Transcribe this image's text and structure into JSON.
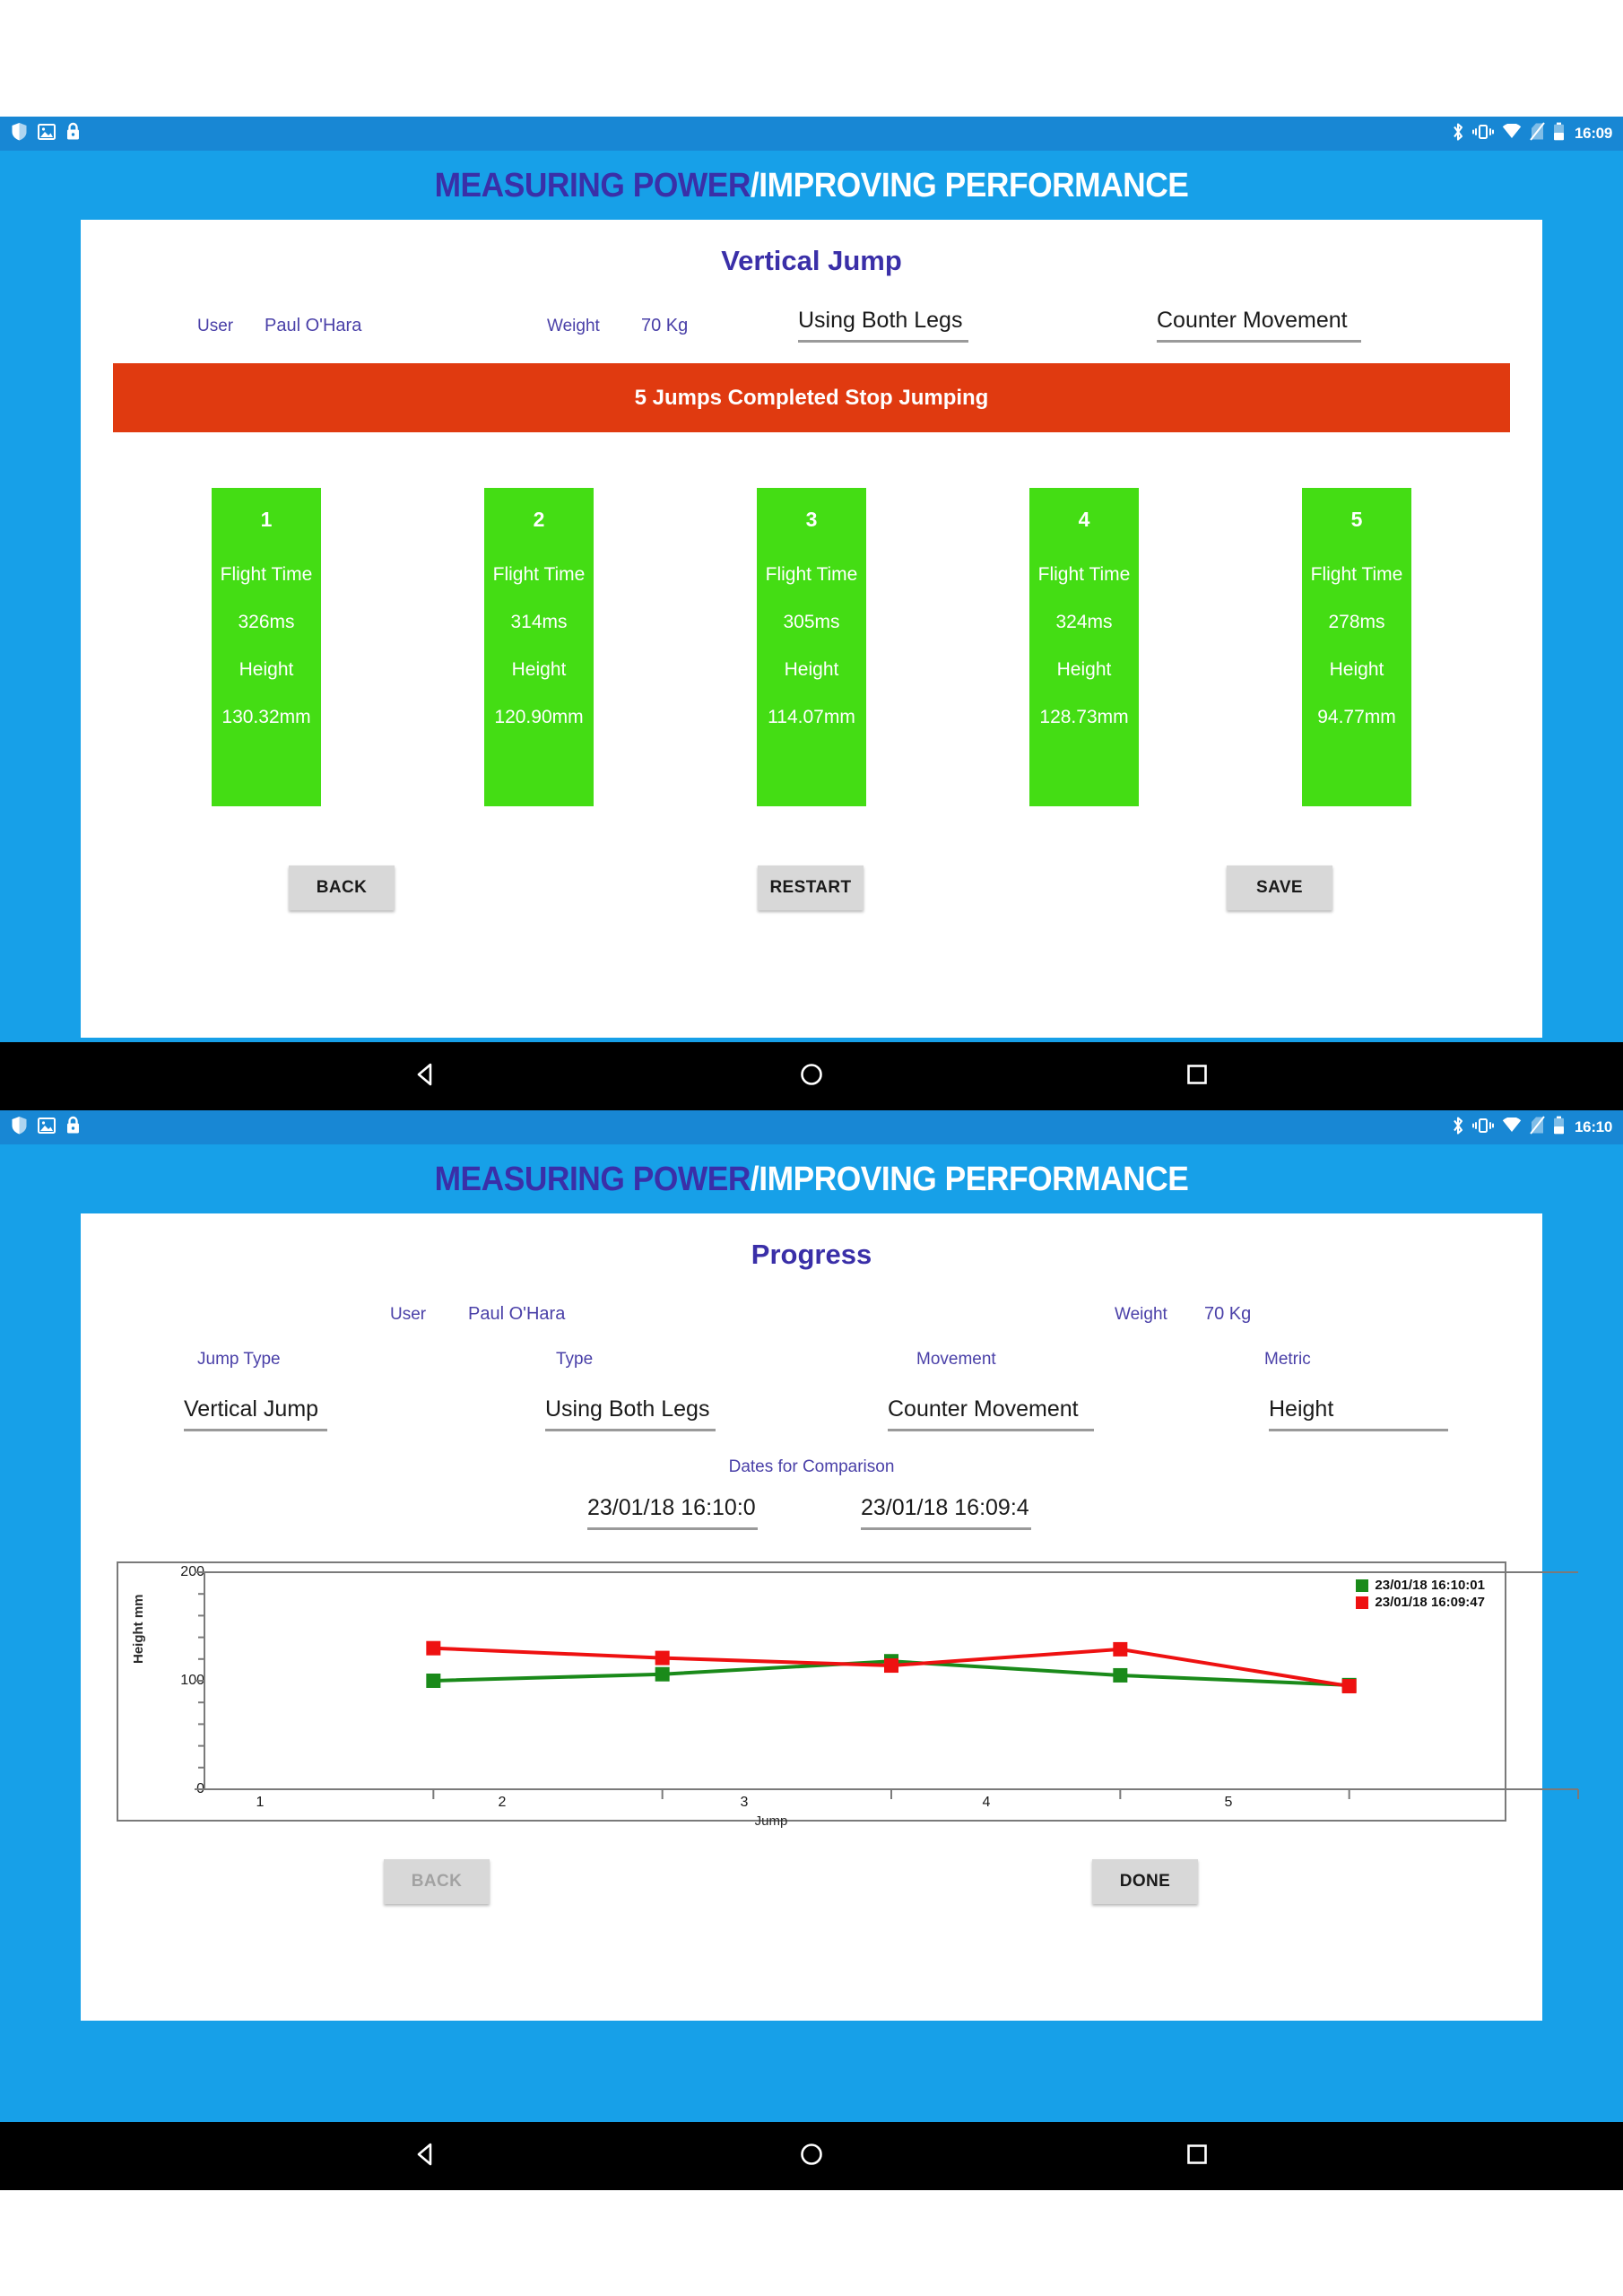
{
  "brand": {
    "part1": "MEASURING POWER",
    "part2": "/IMPROVING PERFORMANCE",
    "color1": "#3a2fa8",
    "color2": "#ffffff"
  },
  "screen1": {
    "statusbar": {
      "time": "16:09",
      "left_icons": [
        "shield-icon",
        "image-icon",
        "lock-icon"
      ],
      "right_icons": [
        "bluetooth-icon",
        "vibrate-icon",
        "wifi-icon",
        "no-sim-icon",
        "battery-icon"
      ]
    },
    "title": "Vertical Jump",
    "fields": {
      "user_label": "User",
      "user_value": "Paul O'Hara",
      "weight_label": "Weight",
      "weight_value": "70  Kg",
      "legs_value": "Using Both Legs",
      "movement_value": "Counter Movement"
    },
    "banner": "5 Jumps Completed Stop Jumping",
    "card_labels": {
      "flight_time": "Flight Time",
      "height": "Height"
    },
    "jumps": [
      {
        "num": "1",
        "flight_time": "326ms",
        "height": "130.32mm"
      },
      {
        "num": "2",
        "flight_time": "314ms",
        "height": "120.90mm"
      },
      {
        "num": "3",
        "flight_time": "305ms",
        "height": "114.07mm"
      },
      {
        "num": "4",
        "flight_time": "324ms",
        "height": "128.73mm"
      },
      {
        "num": "5",
        "flight_time": "278ms",
        "height": "94.77mm"
      }
    ],
    "buttons": {
      "back": "BACK",
      "restart": "RESTART",
      "save": "SAVE"
    },
    "card_color": "#44dd14",
    "banner_color": "#e03a10"
  },
  "screen2": {
    "statusbar": {
      "time": "16:10",
      "left_icons": [
        "shield-icon",
        "image-icon",
        "lock-icon"
      ],
      "right_icons": [
        "bluetooth-icon",
        "vibrate-icon",
        "wifi-icon",
        "no-sim-icon",
        "battery-icon"
      ]
    },
    "title": "Progress",
    "fields": {
      "user_label": "User",
      "user_value": "Paul O'Hara",
      "weight_label": "Weight",
      "weight_value": "70  Kg",
      "jump_type_label": "Jump Type",
      "jump_type_value": "Vertical Jump",
      "type_label": "Type",
      "type_value": "Using Both Legs",
      "movement_label": "Movement",
      "movement_value": "Counter Movement",
      "metric_label": "Metric",
      "metric_value": "Height"
    },
    "dates": {
      "title": "Dates for Comparison",
      "date1": "23/01/18 16:10:0",
      "date2": "23/01/18 16:09:4"
    },
    "buttons": {
      "back": "BACK",
      "done": "DONE"
    }
  },
  "chart_data": {
    "type": "line",
    "title": "",
    "xlabel": "Jump",
    "ylabel": "Height mm",
    "categories": [
      "1",
      "2",
      "3",
      "4",
      "5"
    ],
    "x": [
      1,
      2,
      3,
      4,
      5
    ],
    "ylim": [
      0,
      200
    ],
    "yticks": [
      0,
      100,
      200
    ],
    "ytick_labels": [
      "0",
      "100",
      "200"
    ],
    "minor_tick_step": 20,
    "grid": false,
    "legend_position": "top-right",
    "series": [
      {
        "name": "23/01/18 16:10:01",
        "color": "#1a8a1a",
        "marker": "square",
        "values": [
          100,
          106,
          118,
          105,
          96
        ]
      },
      {
        "name": "23/01/18 16:09:47",
        "color": "#ee1111",
        "marker": "square",
        "values": [
          130,
          121,
          114,
          129,
          95
        ]
      }
    ]
  },
  "navbar": {
    "back": "back-triangle-icon",
    "home": "home-circle-icon",
    "recents": "recents-square-icon"
  }
}
